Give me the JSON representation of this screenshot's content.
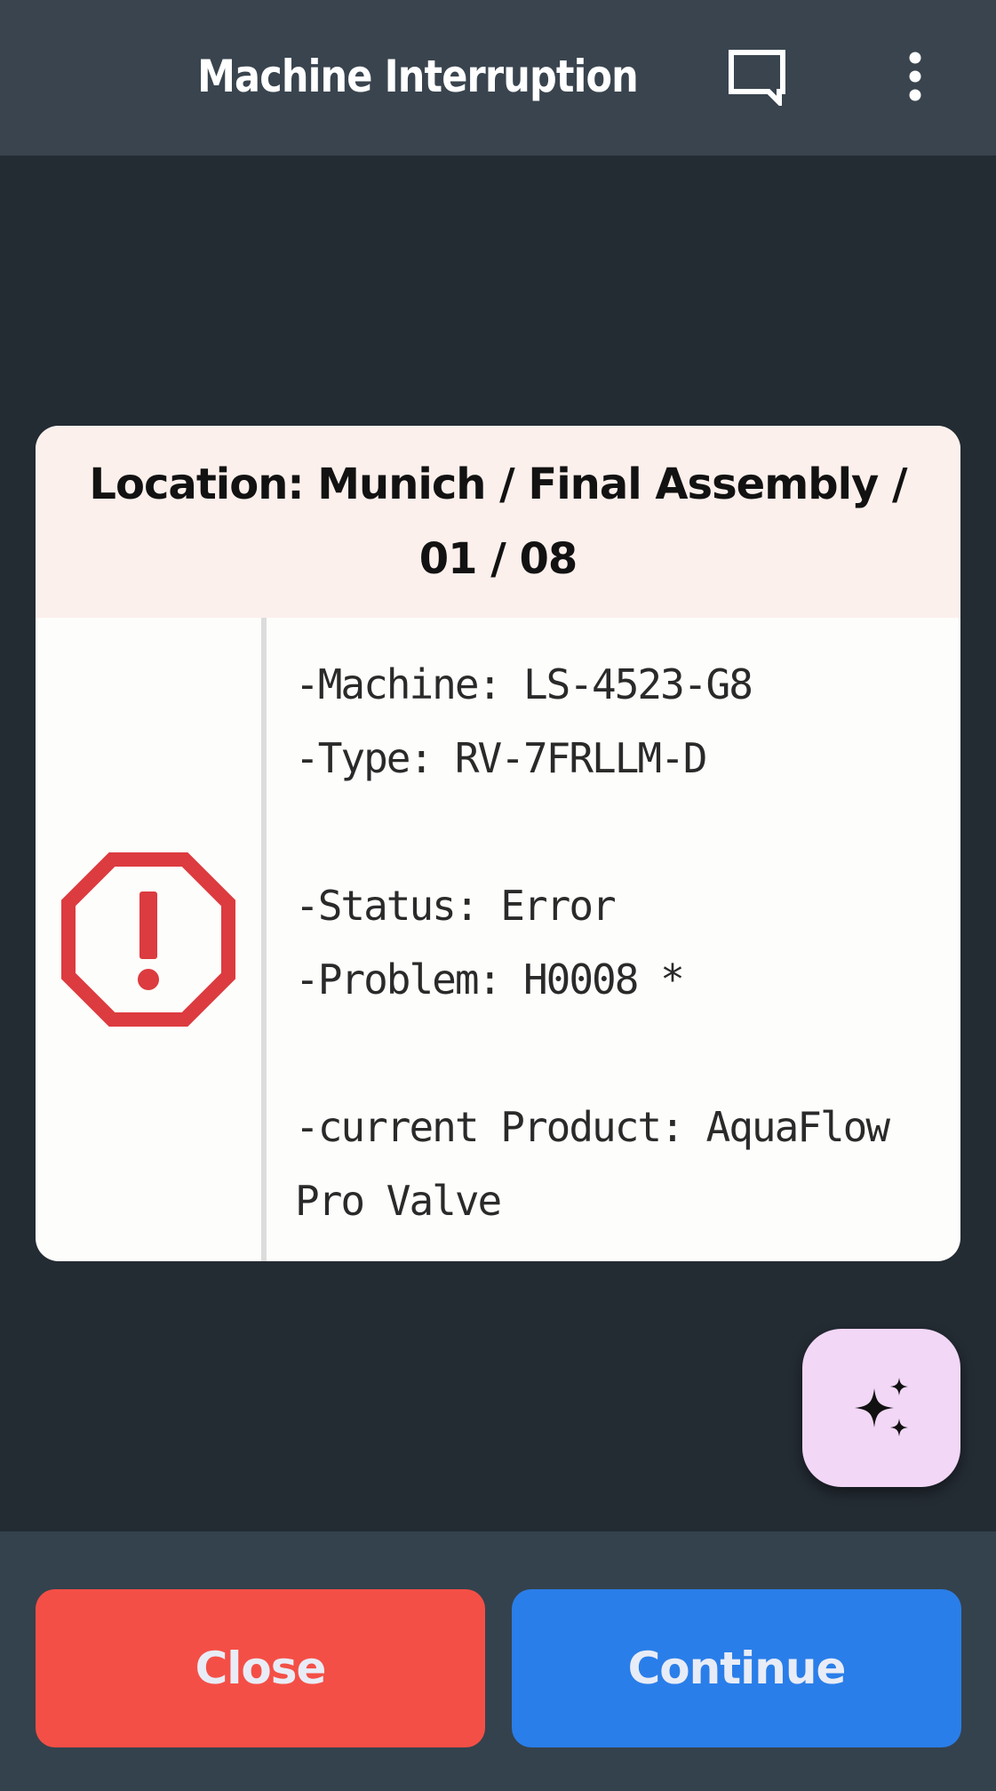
{
  "appbar": {
    "title": "Machine Interruption",
    "chat_icon": "chat-bubble-icon",
    "more_icon": "more-vert-icon"
  },
  "card": {
    "location": "Location: Munich / Final Assembly / 01 / 08",
    "status_icon": "error-octagon-icon",
    "machine": "-Machine: LS-4523-G8",
    "type": "-Type: RV-7FRLLM-D",
    "status": "-Status: Error",
    "problem": "-Problem: H0008 *",
    "product": "-current Product: AquaFlow Pro Valve"
  },
  "fab": {
    "icon": "sparkles-icon"
  },
  "actions": {
    "close_label": "Close",
    "continue_label": "Continue"
  },
  "colors": {
    "background": "#232b33",
    "appbar": "#39444e",
    "card_header": "#fcf0ec",
    "error_red": "#dc3b3f",
    "fab": "#f2d7f6",
    "close_button": "#f44f46",
    "continue_button": "#2a7ee9"
  }
}
